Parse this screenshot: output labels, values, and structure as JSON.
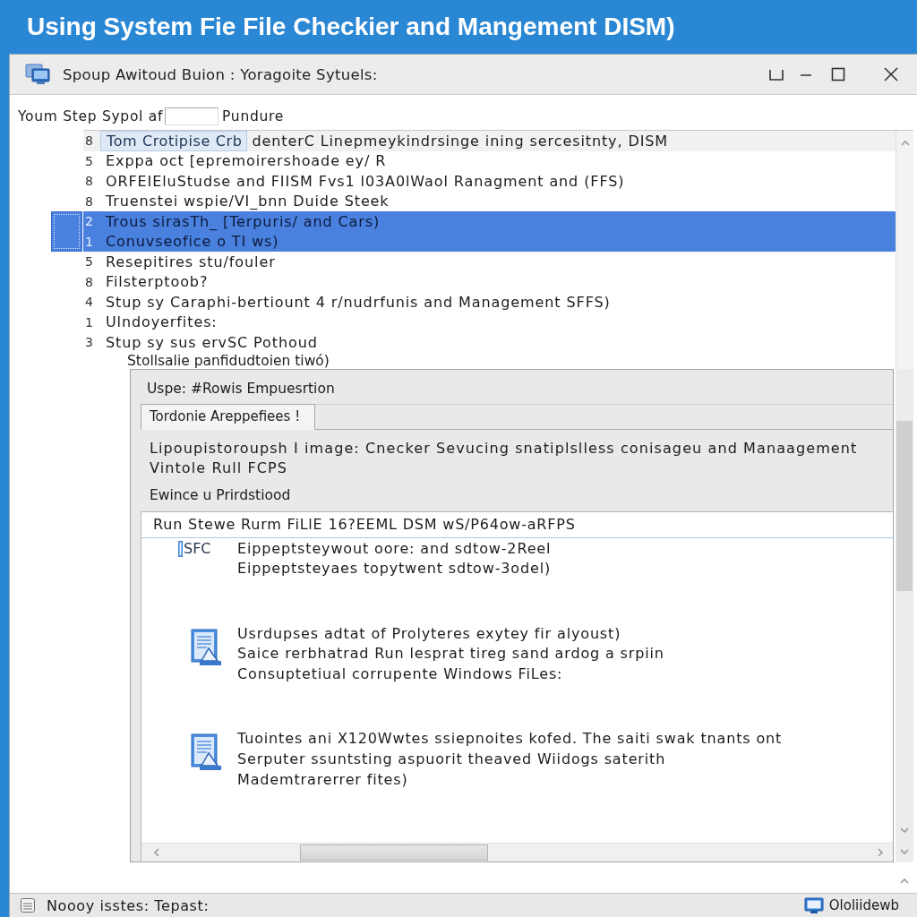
{
  "page_title": "Using System Fie File Checkier and Mangement DISM)",
  "window": {
    "title": "Spoup Awitoud Buion : Yoragoite Sytuels:"
  },
  "step_line": {
    "label": "Youm Step Sypol af",
    "suffix": "Pundure"
  },
  "list": {
    "rows": [
      {
        "number": "8",
        "tag": "Tom Crotipise Crb",
        "text": "denterC Linepmeykindrsinge ining sercesitnty, DISM",
        "hovered": true,
        "selected": false
      },
      {
        "number": "5",
        "text": "Exppa oct [epremoirershoade ey/ R",
        "hovered": false,
        "selected": false
      },
      {
        "number": "8",
        "text": "ORFEIEluStudse and FIISM Fvs1 l03A0lWaol Ranagment and (FFS)",
        "hovered": false,
        "selected": false
      },
      {
        "number": "8",
        "text": "Truenstei wspie/VI_bnn Duide Steek",
        "hovered": false,
        "selected": false
      },
      {
        "number": "2",
        "text": "Trous sirasTh_ [Terpuris/ and Cars)",
        "hovered": false,
        "selected": true
      },
      {
        "number": "1",
        "text": "Conuvseofice o TI ws)",
        "hovered": false,
        "selected": true
      },
      {
        "number": "5",
        "text": "Resepitires stu/fouler",
        "hovered": false,
        "selected": false
      },
      {
        "number": "8",
        "text": "Filsterptoob?",
        "hovered": false,
        "selected": false
      },
      {
        "number": "4",
        "text": "Stup sy Caraphi-bertiount 4 r/nudrfunis and Management SFFS)",
        "hovered": false,
        "selected": false
      },
      {
        "number": "1",
        "text": "Ulndoyerfites:",
        "hovered": false,
        "selected": false
      },
      {
        "number": "3",
        "text": "Stup sy sus ervSC Pothoud",
        "hovered": false,
        "selected": false
      }
    ],
    "footer_text": "Stollsalie panfidudtoien tiwó)"
  },
  "panel": {
    "title": "Uspe: #Rowis Empuesrtion",
    "tabs": [
      {
        "label": "Tordonie Areppefiees !",
        "selected": true
      }
    ],
    "description": [
      "Lipoupistoroupsh I image: Cnecker Sevucing snatiplslless conisageu and Manaagement",
      "Vintole Rull FCPS"
    ],
    "section_label": "Ewince u Prirdstiood",
    "command": "Run Stewe Rurm FiLlE 16?EEML DSM wS/P64ow-aRFPS",
    "entries": [
      {
        "kind": "label",
        "label": "SFC",
        "lines": [
          "Eippeptsteywout oore: and sdtow-2Reel",
          "Eippeptsteyaes topytwent sdtow-3odel)"
        ]
      },
      {
        "kind": "document",
        "lines": [
          "Usrdupses adtat of Prolyteres exytey fir alyoust)",
          "Saice rerbhatrad Run lesprat tireg sand ardog a srpiin",
          "Consuptetiual corrupente Windows FiLes:"
        ]
      },
      {
        "kind": "document",
        "lines": [
          "Tuointes ani X120Wwtes ssiepnoites kofed. The saiti swak tnants ont",
          "Serputer ssuntsting aspuorit theaved Wiidogs saterith",
          "Mademtrarerrer fites)"
        ]
      }
    ]
  },
  "status_bar": {
    "text": "Noooy isstes: Tepast:",
    "right_text": "Ololiidewb"
  }
}
